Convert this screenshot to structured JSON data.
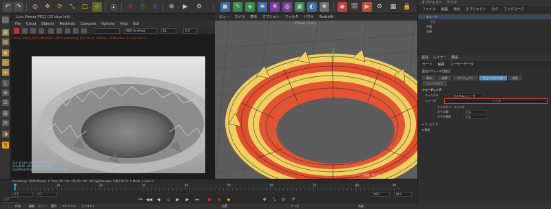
{
  "app": {
    "live_viewer_title": "Live Viewer PR11 (22 days left)"
  },
  "live_viewer": {
    "menu": [
      "File",
      "Cloud",
      "Objects",
      "Materials",
      "Compare",
      "Options",
      "Help",
      "GUI"
    ],
    "toolbar": {
      "tonemap": "HDR tonemap",
      "mode": "DL",
      "value": "0.6"
    },
    "status": "Check: 19ms, 20ms  MeshGen: 28ms  Update[G]: 0ms  Mesh: 1  Nodes: 16  Movable: 0  in.Cached: 0",
    "stats": [
      "Out of core used/max: 0Kb/4Gb",
      "Grey8/16: 0/0       Rgb32/64: 0/0",
      "Used/free/total vram: 1947Mb/8.9Gb/8Gb",
      "Rendering: 100%   Ms/sec: 0   Time: 00 : 00 : 00/ 00 : 00 : 00   Spp/maxspp: 128/128   Tri: 0   Mesh: 1   Hair: 0"
    ]
  },
  "viewport": {
    "menu": [
      "ビュー",
      "カメラ",
      "表示",
      "オプション",
      "フィルタ",
      "パネル",
      "Redshift"
    ],
    "camera_label": "デフォルトカメラ",
    "footer": "グリッド間隔 : 50 cm"
  },
  "right_panel": {
    "top_tabs": [
      "オブジェクト",
      "テイク"
    ],
    "menu": [
      "ファイル",
      "編集",
      "表示",
      "オブジェクト",
      "タグ",
      "ブックマーク"
    ],
    "objects": [
      "チューブ",
      "変形",
      "平面",
      "光源"
    ],
    "attr_tabs_top": [
      "属性",
      "レイヤー",
      "構造"
    ],
    "attr_menu": [
      "モード",
      "編集",
      "ユーザーデータ"
    ],
    "deformer_title": "変位デフォーマ [変位]",
    "attr_tabs": [
      "基本",
      "座標",
      "オブジェクト",
      "シェーディング",
      "減衰"
    ],
    "attr_tab_row2": [
      "フォールオフ"
    ],
    "section_title": "シェーディング",
    "channel_label": "チャンネル",
    "channel_value": "カスタムシェーダ",
    "shader_label": "シェーダ",
    "shader_value": "ノイズ",
    "sub_items": [
      {
        "label": "テクスチャ・フィルタ",
        "value": ""
      },
      {
        "label": "ボケの量",
        "value": "0 %"
      },
      {
        "label": "ボケの強度",
        "value": "0 %"
      }
    ],
    "collapsed_sections": [
      "マッピング",
      "強度"
    ]
  },
  "timeline": {
    "ticks": [
      "0",
      "10",
      "20",
      "30",
      "40",
      "50",
      "60",
      "70",
      "80",
      "90"
    ],
    "start_field": "0 F",
    "min_field": "0 F",
    "max_field": "90 F",
    "end_field": "90 F",
    "current_frame": "0 F"
  },
  "bottom_menus": {
    "left": [
      "作成",
      "編集",
      "ビュー",
      "選択",
      "マテリアル",
      "テクスチャ"
    ],
    "mid": [
      "位置"
    ],
    "right": [
      "サイズ",
      "角度"
    ]
  },
  "colors": {
    "highlight_red": "#e0402a",
    "torus_yellow": "#f0d060",
    "accent_blue": "#5a8fb8"
  }
}
